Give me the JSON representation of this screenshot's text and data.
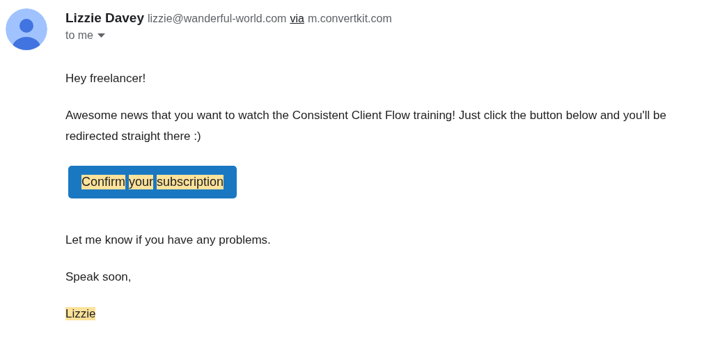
{
  "sender": {
    "name": "Lizzie Davey",
    "email": "lizzie@wanderful-world.com",
    "via": "via",
    "domain": "m.convertkit.com"
  },
  "recipient": {
    "label": "to me"
  },
  "body": [
    {
      "kind": "text",
      "text": "Hey freelancer!",
      "highlighted": false
    },
    {
      "kind": "text",
      "text": "Awesome news that you want to watch the Consistent Client Flow training! Just click the button below and you'll be redirected straight there :)",
      "highlighted": false
    },
    {
      "kind": "button",
      "text": "Confirm your subscription",
      "highlighted": true
    },
    {
      "kind": "text",
      "text": "Let me know if you have any problems.",
      "highlighted": false
    },
    {
      "kind": "text",
      "text": "Speak soon,",
      "highlighted": false
    },
    {
      "kind": "text",
      "text": "Lizzie",
      "highlighted": true
    }
  ]
}
